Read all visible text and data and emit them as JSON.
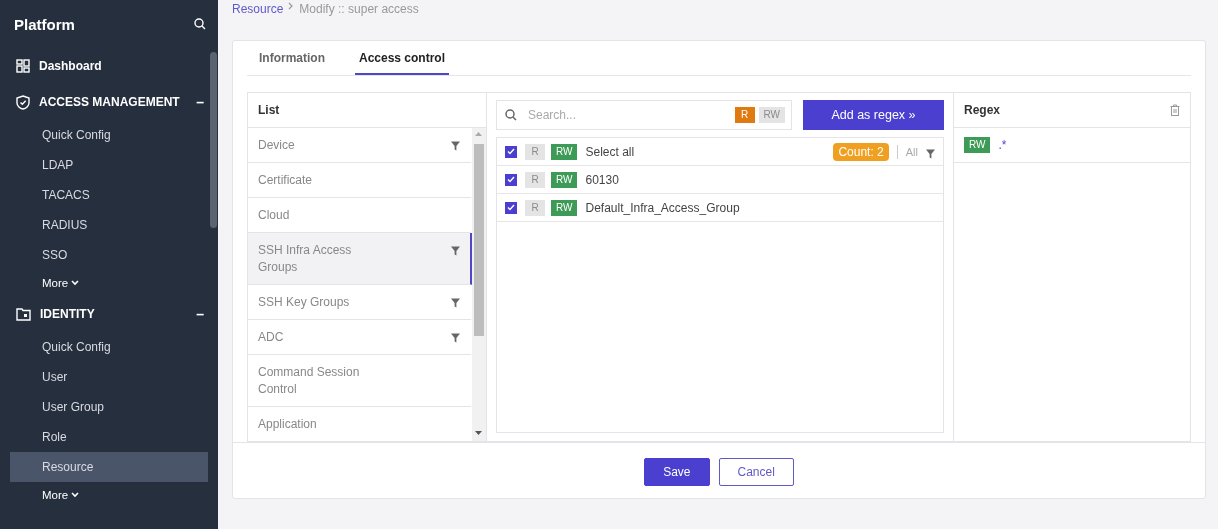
{
  "sidebar": {
    "title": "Platform",
    "sections": [
      {
        "label": "Dashboard"
      },
      {
        "label": "ACCESS MANAGEMENT",
        "toggle": "–",
        "items": [
          {
            "label": "Quick Config",
            "selected": false
          },
          {
            "label": "LDAP",
            "selected": false
          },
          {
            "label": "TACACS",
            "selected": false
          },
          {
            "label": "RADIUS",
            "selected": false
          },
          {
            "label": "SSO",
            "selected": false
          }
        ],
        "more": "More"
      },
      {
        "label": "IDENTITY",
        "toggle": "–",
        "items": [
          {
            "label": "Quick Config",
            "selected": false
          },
          {
            "label": "User",
            "selected": false
          },
          {
            "label": "User Group",
            "selected": false
          },
          {
            "label": "Role",
            "selected": false
          },
          {
            "label": "Resource",
            "selected": true
          }
        ],
        "more": "More"
      }
    ]
  },
  "breadcrumb": {
    "link": "Resource",
    "current": "Modify :: super access"
  },
  "tabs": [
    {
      "label": "Information",
      "selected": false
    },
    {
      "label": "Access control",
      "selected": true
    }
  ],
  "list": {
    "title": "List",
    "items": [
      {
        "label": "Device",
        "filtered": true,
        "selected": false
      },
      {
        "label": "Certificate",
        "filtered": false,
        "selected": false
      },
      {
        "label": "Cloud",
        "filtered": false,
        "selected": false
      },
      {
        "label": "SSH Infra Access Groups",
        "filtered": true,
        "selected": true
      },
      {
        "label": "SSH Key Groups",
        "filtered": true,
        "selected": false
      },
      {
        "label": "ADC",
        "filtered": true,
        "selected": false
      },
      {
        "label": "Command Session Control",
        "filtered": false,
        "selected": false
      },
      {
        "label": "Application",
        "filtered": false,
        "selected": false
      }
    ]
  },
  "search": {
    "placeholder": "Search...",
    "badges": [
      {
        "label": "R",
        "kind": "read",
        "on": true
      },
      {
        "label": "RW",
        "kind": "readwrite",
        "on": false
      }
    ]
  },
  "add_button": "Add as regex »",
  "rows": [
    {
      "label": "Select all",
      "checked": true,
      "badges": [
        {
          "label": "R",
          "kind": "read",
          "on": false
        },
        {
          "label": "RW",
          "kind": "readwrite",
          "on": true
        }
      ]
    },
    {
      "label": "60130",
      "checked": true,
      "badges": [
        {
          "label": "R",
          "kind": "read",
          "on": false
        },
        {
          "label": "RW",
          "kind": "readwrite",
          "on": true
        }
      ]
    },
    {
      "label": "Default_Infra_Access_Group",
      "checked": true,
      "badges": [
        {
          "label": "R",
          "kind": "read",
          "on": false
        },
        {
          "label": "RW",
          "kind": "readwrite",
          "on": true
        }
      ]
    }
  ],
  "count": "Count: 2",
  "filter_label": "All",
  "regex": {
    "title": "Regex",
    "entries": [
      {
        "badge": {
          "label": "RW",
          "kind": "readwrite",
          "on": true
        },
        "pattern": ".*"
      }
    ]
  },
  "buttons": [
    {
      "label": "Save",
      "kind": "primary"
    },
    {
      "label": "Cancel",
      "kind": "secondary"
    }
  ]
}
